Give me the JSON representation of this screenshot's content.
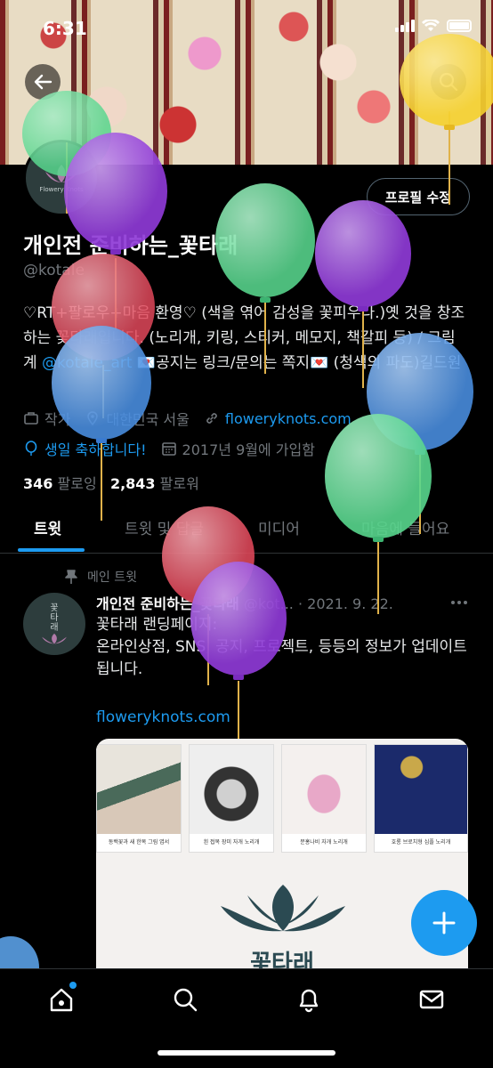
{
  "status": {
    "time": "6:31"
  },
  "profile": {
    "edit_label": "프로필 수정",
    "name": "개인전 준비하는_꽃타래",
    "handle": "@kotale",
    "bio_1": "♡RT+팔로우+마음 환영♡ (색을 엮어 감성을 꽃피우다.)옛 것을 창조하는 꽃타래입니다. (노리개, 키링, 스티커, 메모지, 책갈피 등) / 그림계 ",
    "bio_link": "@kotale_art",
    "bio_2": " 💌공지는 링크/문의는 쪽지💌 (청색의 파도)길드원",
    "category": "작가",
    "location": "대한민국 서울",
    "website": "floweryknots.com",
    "birthday": "생일 축하합니다!",
    "joined": "2017년 9월에 가입함",
    "following_count": "346",
    "following_label": "팔로잉",
    "followers_count": "2,843",
    "followers_label": "팔로워",
    "avatar_logo_text": "Flowery Knots"
  },
  "tabs": [
    "트윗",
    "트윗 및 답글",
    "미디어",
    "마음에 들어요"
  ],
  "tweet": {
    "pinned_label": "메인 트윗",
    "author": "개인전 준비하는_꽃타래",
    "handle": "@kot...",
    "date": "· 2021. 9. 22.",
    "line1": "꽃타래 랜딩페이지:",
    "line2": "온라인상점, SNS, 공지, 프로젝트, 등등의 정보가 업데이트 됩니다.",
    "link": "floweryknots.com",
    "avatar_text": "꽃\n타\n래",
    "card": {
      "products": [
        "동백꽃과 새 한복 그림 엽서",
        "흰 접목 장미 자개 노리개",
        "분홍나비 자개 노리개",
        "호롱 브로치형 심플 노리개"
      ],
      "brand": "꽃타래"
    }
  },
  "colors": {
    "accent": "#1d9bf0",
    "background": "#000000",
    "muted": "#71767b"
  }
}
